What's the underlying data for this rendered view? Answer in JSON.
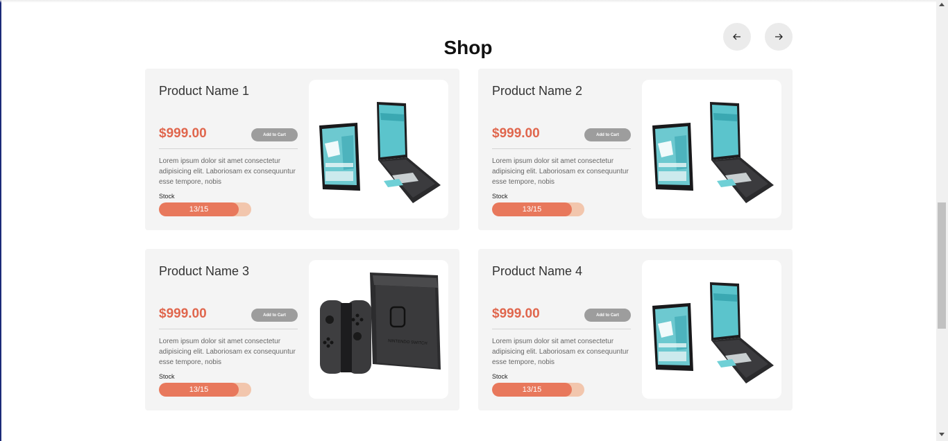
{
  "shop": {
    "title": "Shop",
    "prev_icon": "arrow-left-icon",
    "next_icon": "arrow-right-icon"
  },
  "colors": {
    "price": "#e0664d",
    "stock_fill": "#e8785c",
    "stock_track": "#f2c6ad",
    "cart_button": "#9d9d9d",
    "card_bg": "#f4f4f4"
  },
  "products": [
    {
      "name": "Product Name 1",
      "price": "$999.00",
      "cart_label": "Add to Cart",
      "description": "Lorem ipsum dolor sit amet consectetur adipisicing elit. Laboriosam ex consequuntur esse tempore, nobis",
      "stock_label": "Stock",
      "stock_text": "13/15",
      "stock_fraction": 0.867,
      "image": "tablet-laptop-image"
    },
    {
      "name": "Product Name 2",
      "price": "$999.00",
      "cart_label": "Add to Cart",
      "description": "Lorem ipsum dolor sit amet consectetur adipisicing elit. Laboriosam ex consequuntur esse tempore, nobis",
      "stock_label": "Stock",
      "stock_text": "13/15",
      "stock_fraction": 0.867,
      "image": "tablet-laptop-image"
    },
    {
      "name": "Product Name 3",
      "price": "$999.00",
      "cart_label": "Add to Cart",
      "description": "Lorem ipsum dolor sit amet consectetur adipisicing elit. Laboriosam ex consequuntur esse tempore, nobis",
      "stock_label": "Stock",
      "stock_text": "13/15",
      "stock_fraction": 0.867,
      "image": "game-console-image",
      "image_text": "NINTENDO SWITCH"
    },
    {
      "name": "Product Name 4",
      "price": "$999.00",
      "cart_label": "Add to Cart",
      "description": "Lorem ipsum dolor sit amet consectetur adipisicing elit. Laboriosam ex consequuntur esse tempore, nobis",
      "stock_label": "Stock",
      "stock_text": "13/15",
      "stock_fraction": 0.867,
      "image": "tablet-laptop-image"
    }
  ]
}
